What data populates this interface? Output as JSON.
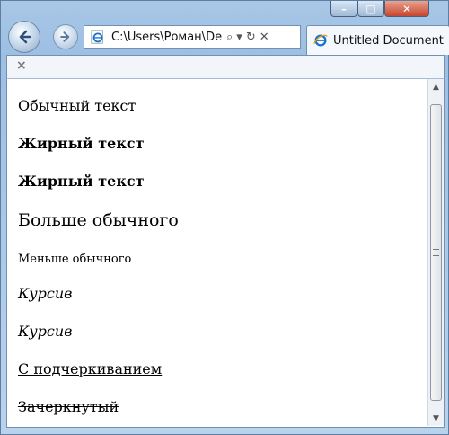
{
  "window": {
    "controls": {
      "minimize_glyph": "–",
      "maximize_glyph": "□",
      "close_glyph": "✕"
    }
  },
  "toolbar": {
    "address": "C:\\Users\\Роман\\De",
    "search_glyph": "⌕",
    "dropdown_glyph": "▾",
    "refresh_glyph": "↻",
    "stop_glyph": "✕"
  },
  "tab": {
    "label": "Untitled Document"
  },
  "commandbar": {
    "close_glyph": "×"
  },
  "content": {
    "lines": [
      "Обычный текст",
      "Жирный текст",
      "Жирный текст",
      "Больше обычного",
      "Меньше обычного",
      "Курсив",
      "Курсив",
      "С подчеркиванием",
      "Зачеркнутый"
    ]
  },
  "scrollbar": {
    "up_glyph": "▲",
    "down_glyph": "▼"
  },
  "colors": {
    "frame": "#9dbfe3",
    "accent": "#1a73c9",
    "close": "#c8452e"
  }
}
